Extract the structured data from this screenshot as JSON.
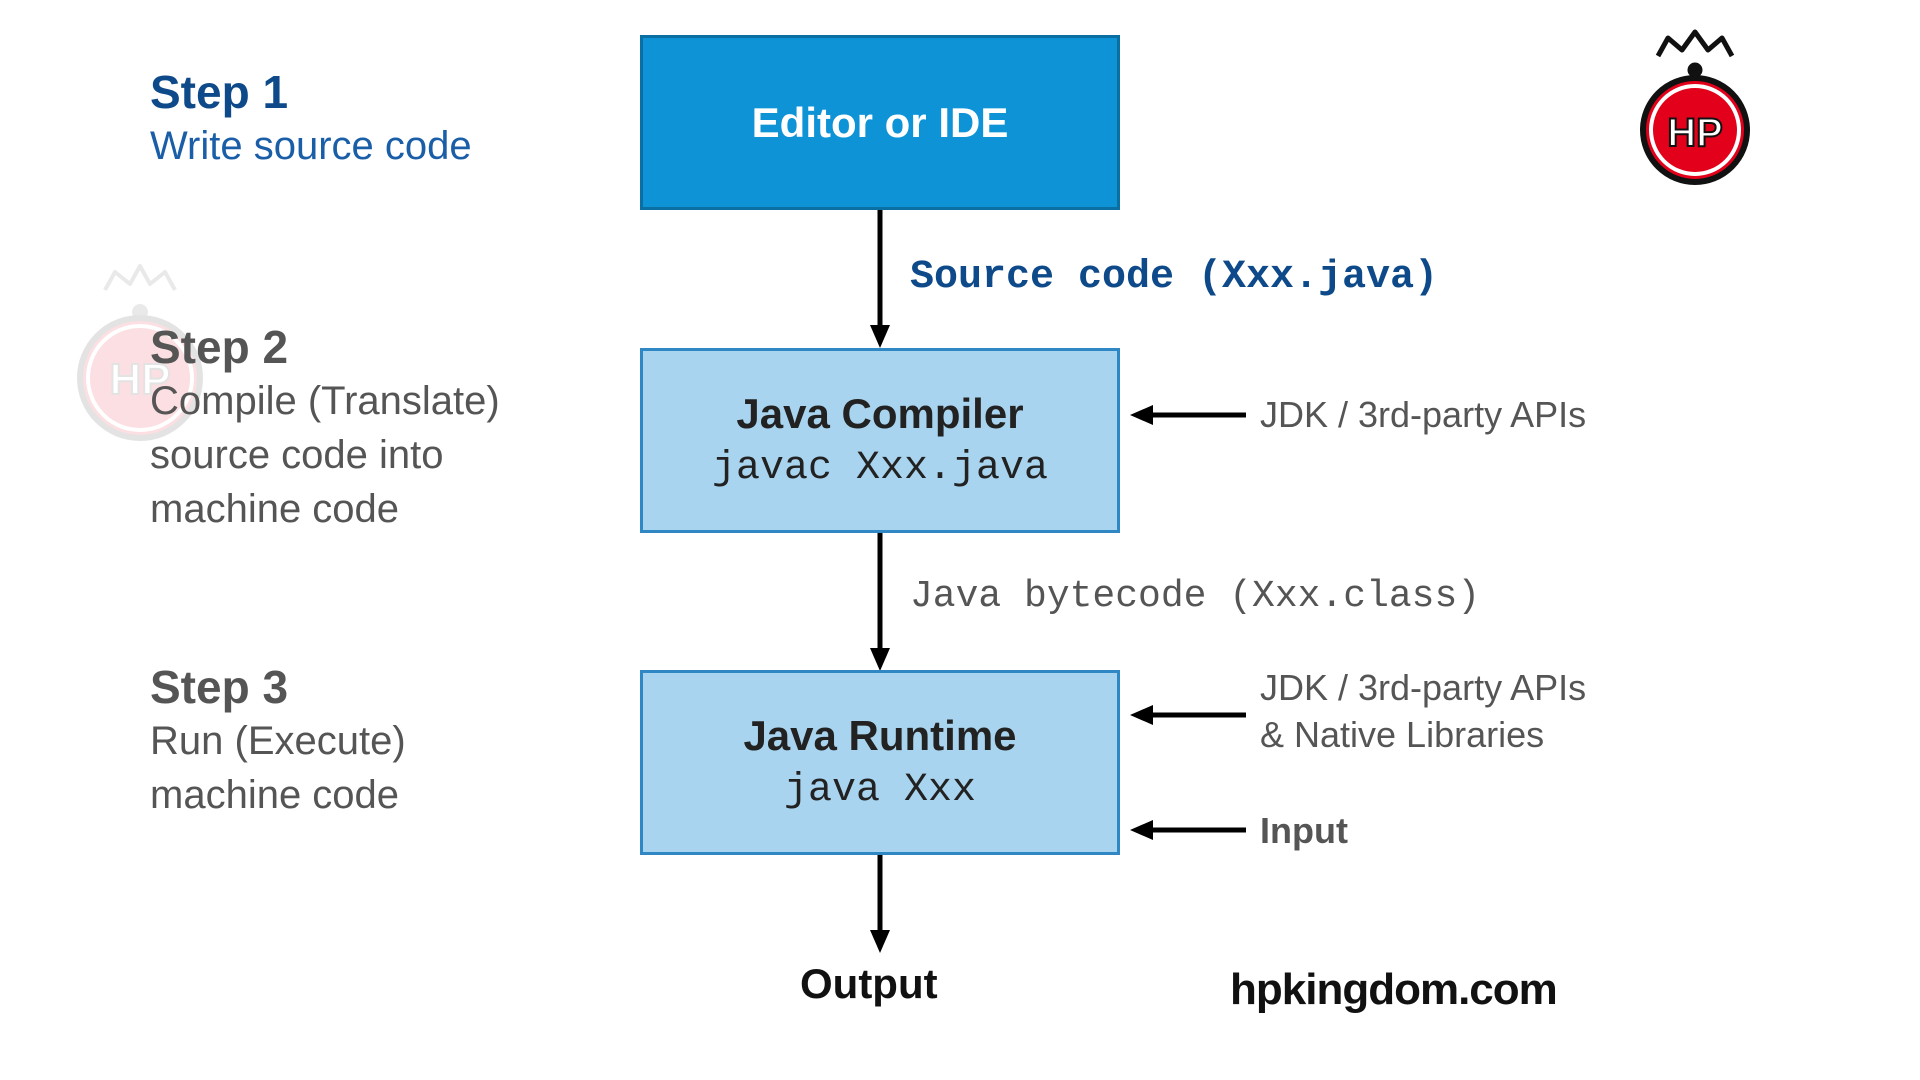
{
  "steps": [
    {
      "head": "Step 1",
      "sub": "Write source code"
    },
    {
      "head": "Step 2",
      "sub": "Compile (Translate)\nsource code into\nmachine code"
    },
    {
      "head": "Step 3",
      "sub": "Run (Execute)\nmachine code"
    }
  ],
  "boxes": {
    "editor": {
      "title": "Editor or IDE"
    },
    "compiler": {
      "title": "Java Compiler",
      "cmd": "javac Xxx.java"
    },
    "runtime": {
      "title": "Java Runtime",
      "cmd": "java Xxx"
    }
  },
  "arrows": {
    "source": "Source code (Xxx.java)",
    "bytecode": "Java bytecode (Xxx.class)",
    "output": "Output"
  },
  "side": {
    "apis1": "JDK / 3rd-party APIs",
    "apis2": "JDK / 3rd-party APIs\n& Native Libraries",
    "input": "Input"
  },
  "brand": "hpkingdom.com",
  "logo_text": "HP",
  "colors": {
    "blue_dark": "#0e4a8a",
    "blue_box": "#0e93d7",
    "blue_light": "#a8d4ef",
    "red": "#e3001b"
  }
}
